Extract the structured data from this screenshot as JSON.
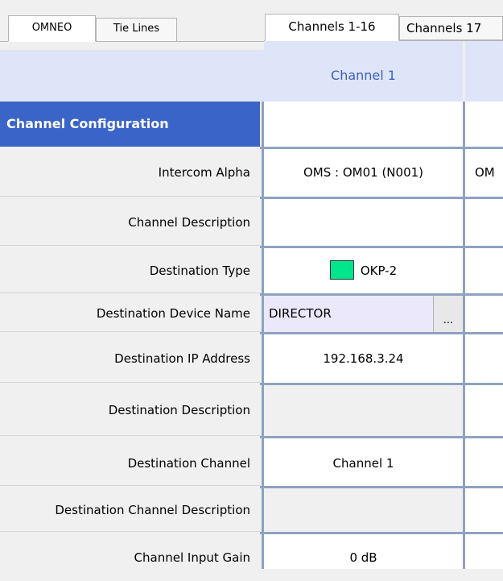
{
  "left_tabs": [
    {
      "label": "OMNEO",
      "active": true
    },
    {
      "label": "Tie Lines",
      "active": false
    }
  ],
  "right_tabs": [
    {
      "label": "Channels 1-16",
      "active": true
    },
    {
      "label": "Channels 17",
      "active": false
    }
  ],
  "columns": {
    "channel1": "Channel 1"
  },
  "section_title": "Channel Configuration",
  "rows": [
    {
      "label": "Intercom Alpha",
      "value": "OMS : OM01 (N001)",
      "value2": "OM"
    },
    {
      "label": "Channel Description",
      "value": ""
    },
    {
      "label": "Destination Type",
      "value": "OKP-2",
      "swatch_color": "#00e68c"
    },
    {
      "label": "Destination Device Name",
      "value": "DIRECTOR",
      "button": "..."
    },
    {
      "label": "Destination IP Address",
      "value": "192.168.3.24"
    },
    {
      "label": "Destination Description",
      "value": ""
    },
    {
      "label": "Destination Channel",
      "value": "Channel 1"
    },
    {
      "label": "Destination Channel Description",
      "value": ""
    },
    {
      "label": "Channel Input Gain",
      "value": "0 dB"
    }
  ],
  "colors": {
    "section_bg": "#3a64c7",
    "header_bg": "#dfe5f8",
    "grid_line": "#8ea2c2",
    "header_text": "#3a5fbf"
  }
}
